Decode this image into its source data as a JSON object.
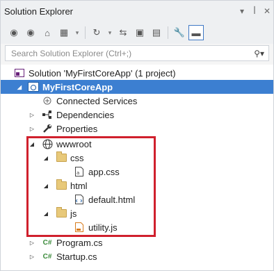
{
  "window": {
    "title": "Solution Explorer",
    "controls": [
      "dropdown-icon",
      "pin-icon",
      "close-icon"
    ]
  },
  "toolbar": {
    "buttons": [
      "back-icon",
      "forward-icon",
      "home-icon",
      "switch-views-icon",
      "dropdown-icon",
      "pending-changes-icon",
      "dropdown-icon",
      "sync-icon",
      "collapse-all-icon",
      "show-all-files-icon",
      "properties-icon",
      "preview-icon"
    ]
  },
  "search": {
    "placeholder": "Search Solution Explorer (Ctrl+;)"
  },
  "tree": {
    "solution": "Solution 'MyFirstCoreApp' (1 project)",
    "project": "MyFirstCoreApp",
    "connected_services": "Connected Services",
    "dependencies": "Dependencies",
    "properties": "Properties",
    "wwwroot": "wwwroot",
    "css": "css",
    "app_css": "app.css",
    "html": "html",
    "default_html": "default.html",
    "js": "js",
    "utility_js": "utility.js",
    "program_cs": "Program.cs",
    "startup_cs": "Startup.cs"
  },
  "colors": {
    "selection": "#3c7fd1",
    "highlight_box": "#d0202d"
  }
}
